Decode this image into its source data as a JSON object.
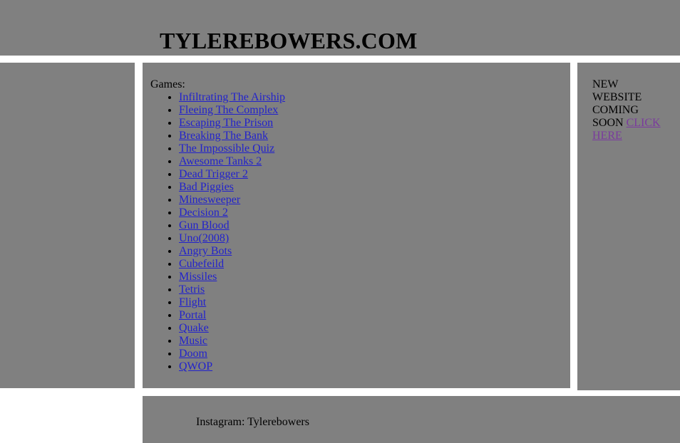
{
  "header": {
    "title": "TYLEREBOWERS.COM"
  },
  "main": {
    "games_heading": "Games:",
    "games": [
      {
        "label": "Infiltrating The Airship"
      },
      {
        "label": "Fleeing The Complex"
      },
      {
        "label": "Escaping The Prison"
      },
      {
        "label": "Breaking The Bank"
      },
      {
        "label": "The Impossible Quiz"
      },
      {
        "label": "Awesome Tanks 2"
      },
      {
        "label": "Dead Trigger 2"
      },
      {
        "label": "Bad Piggies"
      },
      {
        "label": "Minesweeper"
      },
      {
        "label": "Decision 2"
      },
      {
        "label": "Gun Blood"
      },
      {
        "label": "Uno(2008)"
      },
      {
        "label": "Angry Bots"
      },
      {
        "label": "Cubefeild"
      },
      {
        "label": "Missiles"
      },
      {
        "label": "Tetris"
      },
      {
        "label": "Flight"
      },
      {
        "label": "Portal"
      },
      {
        "label": "Quake"
      },
      {
        "label": "Music"
      },
      {
        "label": "Doom"
      },
      {
        "label": "QWOP"
      }
    ]
  },
  "sidebar_right": {
    "notice_text": "NEW WEBSITE COMING SOON ",
    "notice_link": "CLICK HERE"
  },
  "footer": {
    "instagram": "Instagram: Tylerebowers"
  },
  "colors": {
    "panel_gray": "#808080",
    "page_background": "#ffffff",
    "link_blue": "#2222cc",
    "link_visited_purple": "#7a3a9e",
    "text_black": "#000000"
  }
}
